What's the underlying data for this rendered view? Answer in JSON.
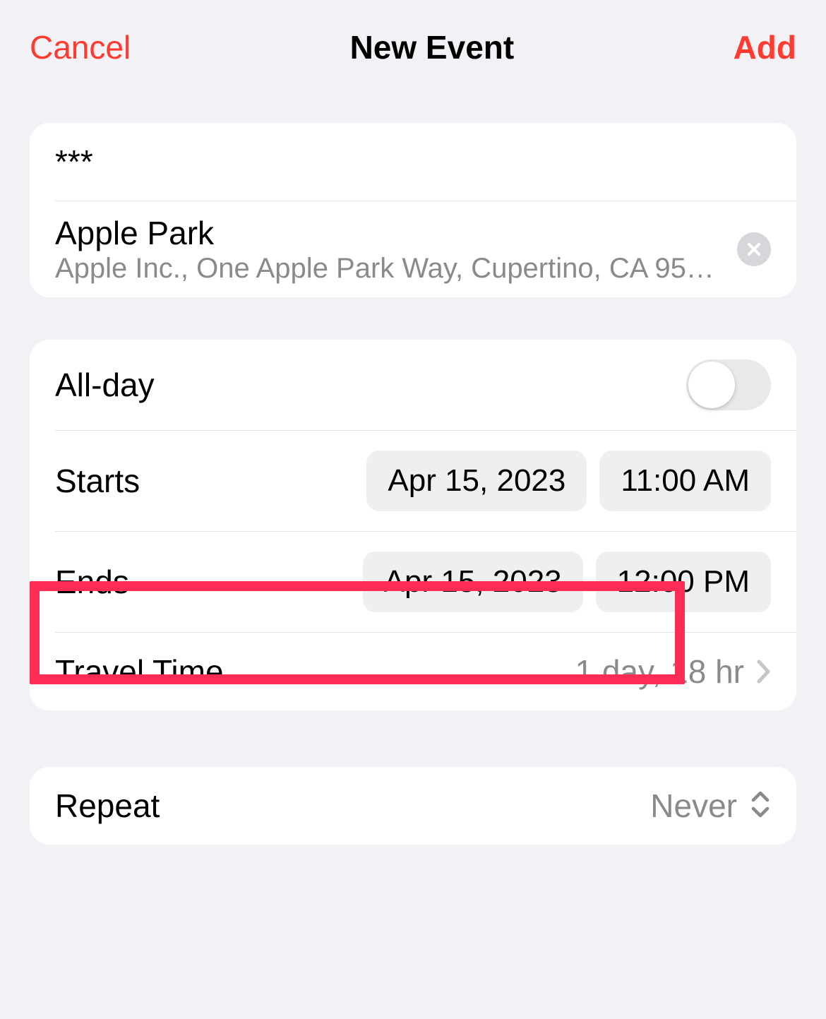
{
  "header": {
    "cancel": "Cancel",
    "title": "New Event",
    "add": "Add"
  },
  "event": {
    "title_value": "***",
    "location": {
      "name": "Apple Park",
      "address": "Apple Inc., One Apple Park Way, Cupertino, CA 95…"
    }
  },
  "allday": {
    "label": "All-day",
    "on": false
  },
  "starts": {
    "label": "Starts",
    "date": "Apr 15, 2023",
    "time": "11:00 AM"
  },
  "ends": {
    "label": "Ends",
    "date": "Apr 15, 2023",
    "time": "12:00 PM"
  },
  "travel": {
    "label": "Travel Time",
    "value": "1 day, 18 hr"
  },
  "repeat": {
    "label": "Repeat",
    "value": "Never"
  }
}
